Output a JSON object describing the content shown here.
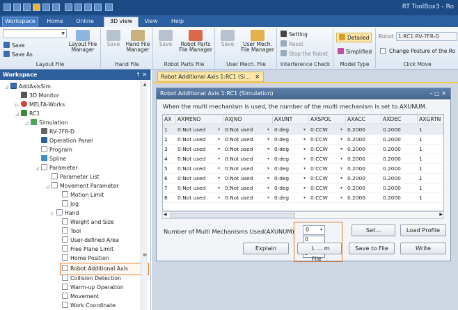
{
  "app": {
    "title": "RT ToolBox3 - Ro"
  },
  "ribbon_tabs": [
    "Workspace",
    "Home",
    "Online",
    "3D view",
    "View",
    "Help"
  ],
  "ribbon": {
    "layout_file": {
      "group_title": "Layout File",
      "save": "Save",
      "save_as": "Save As",
      "manager": "Layout File\nManager"
    },
    "hand_file": {
      "group_title": "Hand File",
      "save": "Save",
      "manager": "Hand File\nManager"
    },
    "robot_parts_file": {
      "group_title": "Robot Parts File",
      "save": "Save",
      "manager": "Robot Parts\nFile Manager"
    },
    "user_mech_file": {
      "group_title": "User Mech. File",
      "save": "Save",
      "manager": "User Mech.\nFile Manager"
    },
    "interference": {
      "group_title": "Interference Check",
      "setting": "Setting",
      "reset": "Reset",
      "stop_robot": "Stop the Robot"
    },
    "model_type": {
      "group_title": "Model Type",
      "detailed": "Detailed",
      "simplified": "Simplified"
    },
    "click_move": {
      "group_title": "Click Move",
      "robot_label": "Robot",
      "robot_value": "1:RC1 RV-7FR-D",
      "change_posture": "Change Posture of the Ro"
    }
  },
  "workspace": {
    "title": "Workspace",
    "pin_controls": "↑ ✕",
    "tree": [
      "AddAxisSim",
      "3D Monitor",
      "MELFA-Works",
      "RC1",
      "Simulation",
      "RV-7FR-D",
      "Operation Panel",
      "Program",
      "Spline",
      "Parameter",
      "Parameter List",
      "Movement Parameter",
      "Motion Limit",
      "Jog",
      "Hand",
      "Weight and Size",
      "Tool",
      "User-defined Area",
      "Free Plane Limit",
      "Home Position",
      "Robot Additional Axis",
      "Collision Detection",
      "Warm-up Operation",
      "Movement",
      "Work Coordinate"
    ]
  },
  "doc_tab": {
    "label": "Robot Additional Axis 1:RC1 (Si...",
    "close": "✕"
  },
  "window": {
    "title": "Robot Additional Axis 1:RC1  (Simulation)",
    "controls": "–  □  ✕",
    "note": "When the multi mechanism is used, the number of the multi mechanism is set to AXUNUM.",
    "columns": [
      "AX",
      "AXMENO",
      "AXJNO",
      "AXUNT",
      "AXSPOL",
      "AXACC",
      "AXDEC",
      "AXGRTN"
    ],
    "rows": [
      [
        "1",
        "0:Not used",
        "0:Not used",
        "0:deg",
        "0:CCW",
        "0.2000",
        "0.2000",
        "1"
      ],
      [
        "2",
        "0:Not used",
        "0:Not used",
        "0:deg",
        "0:CCW",
        "0.2000",
        "0.2000",
        "1"
      ],
      [
        "3",
        "0:Not used",
        "0:Not used",
        "0:deg",
        "0:CCW",
        "0.2000",
        "0.2000",
        "1"
      ],
      [
        "4",
        "0:Not used",
        "0:Not used",
        "0:deg",
        "0:CCW",
        "0.2000",
        "0.2000",
        "1"
      ],
      [
        "5",
        "0:Not used",
        "0:Not used",
        "0:deg",
        "0:CCW",
        "0.2000",
        "0.2000",
        "1"
      ],
      [
        "6",
        "0:Not used",
        "0:Not used",
        "0:deg",
        "0:CCW",
        "0.2000",
        "0.2000",
        "1"
      ],
      [
        "7",
        "0:Not used",
        "0:Not used",
        "0:deg",
        "0:CCW",
        "0.2000",
        "0.2000",
        "1"
      ],
      [
        "8",
        "0:Not used",
        "0:Not used",
        "0:deg",
        "0:CCW",
        "0.2000",
        "0.2000",
        "1"
      ]
    ],
    "mm_label": "Number of Multi Mechanisms Used(AXUNUM)",
    "mm_value": "0",
    "mm_options": [
      "0",
      "1",
      "2"
    ],
    "buttons": {
      "set": "Set...",
      "load_profile": "Load Profile",
      "explain": "Explain",
      "load_file": "L  ... m File",
      "save_to_file": "Save to File",
      "write": "Write"
    }
  },
  "colors": {
    "title_blue": "#1b4a85",
    "highlight_orange": "#e07a2a",
    "tab_yellow": "#fde7a8"
  }
}
